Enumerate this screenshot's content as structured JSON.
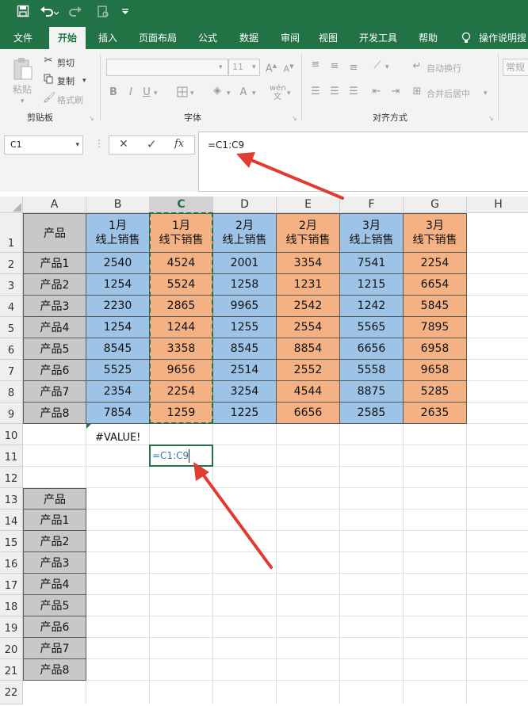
{
  "qat": {
    "save_icon": "save-icon",
    "undo_icon": "undo-icon",
    "redo_icon": "redo-icon",
    "quickprint_icon": "print-preview-icon",
    "more_icon": "dropdown-icon"
  },
  "tabs": [
    "文件",
    "开始",
    "插入",
    "页面布局",
    "公式",
    "数据",
    "审阅",
    "视图",
    "开发工具",
    "帮助"
  ],
  "tell_me": "操作说明搜",
  "ribbon": {
    "paste": "粘贴",
    "cut": "剪切",
    "copy": "复制",
    "format_painter": "格式刷",
    "clipboard": "剪贴板",
    "font_size": "11",
    "bold": "B",
    "italic": "I",
    "underline": "U",
    "font_group": "字体",
    "wrap_text": "自动换行",
    "merge_center": "合并后居中",
    "alignment_group": "对齐方式",
    "number_format": "常规"
  },
  "formula_bar": {
    "name_box": "C1",
    "cancel": "✕",
    "enter": "✓",
    "fx": "fx",
    "formula": "=C1:C9"
  },
  "columns": [
    "A",
    "B",
    "C",
    "D",
    "E",
    "F",
    "G",
    "H"
  ],
  "rows": [
    "1",
    "2",
    "3",
    "4",
    "5",
    "6",
    "7",
    "8",
    "9",
    "10",
    "11",
    "12",
    "13",
    "14",
    "15",
    "16",
    "17",
    "18",
    "19",
    "20",
    "21",
    "22"
  ],
  "table": {
    "header": [
      "产品",
      "1月\n线上销售",
      "1月\n线下销售",
      "2月\n线上销售",
      "2月\n线下销售",
      "3月\n线上销售",
      "3月\n线下销售"
    ],
    "rows": [
      [
        "产品1",
        "2540",
        "4524",
        "2001",
        "3354",
        "7541",
        "2254"
      ],
      [
        "产品2",
        "1254",
        "5524",
        "1258",
        "1231",
        "1215",
        "6654"
      ],
      [
        "产品3",
        "2230",
        "2865",
        "9965",
        "2542",
        "1242",
        "5845"
      ],
      [
        "产品4",
        "1254",
        "1244",
        "1255",
        "2554",
        "5565",
        "7895"
      ],
      [
        "产品5",
        "8545",
        "3358",
        "8545",
        "8854",
        "6656",
        "6958"
      ],
      [
        "产品6",
        "5525",
        "9656",
        "2514",
        "2552",
        "5558",
        "9658"
      ],
      [
        "产品7",
        "2354",
        "2254",
        "3254",
        "4544",
        "8875",
        "5285"
      ],
      [
        "产品8",
        "7854",
        "1259",
        "1225",
        "6656",
        "2585",
        "2635"
      ]
    ]
  },
  "b10": "#VALUE!",
  "c11": "=C1:C9",
  "list": [
    "产品",
    "产品1",
    "产品2",
    "产品3",
    "产品4",
    "产品5",
    "产品6",
    "产品7",
    "产品8"
  ],
  "colors": {
    "excel_green": "#217346",
    "blue_fill": "#9dc3e6",
    "orange_fill": "#f4b183",
    "gray_fill": "#c8c8c8",
    "arrow_red": "#e03c31"
  }
}
